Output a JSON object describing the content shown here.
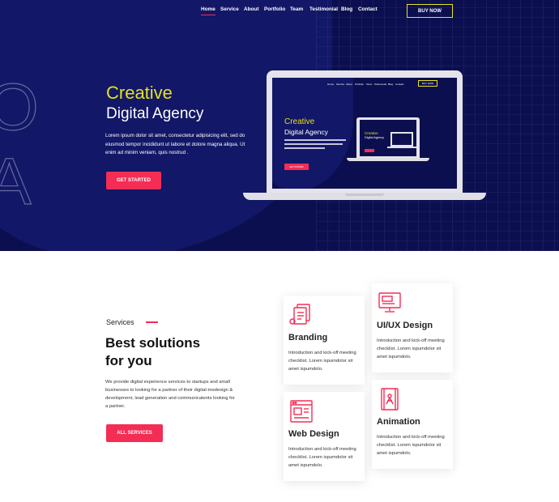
{
  "colors": {
    "navy": "#0c0f4f",
    "accent_red": "#f42d55",
    "accent_yellow": "#e3e11c"
  },
  "nav": {
    "items": [
      "Home",
      "Service",
      "About",
      "Portfolio",
      "Team",
      "Testimonial",
      "Blog",
      "Contact"
    ],
    "active": "Home",
    "buy_label": "BUY NOW"
  },
  "hero": {
    "bg_letters": [
      "O",
      "A"
    ],
    "title_line1": "Creative",
    "title_line2": "Digital Agency",
    "text": "Lorem ipsum dolor sit amet, consectetur adipisicing elit, sed do eiusmod tempor incididunt ut labore et dolore magna aliqua. Ut enim ad minim veniam, quis nostrud .",
    "button_label": "GET STARTED"
  },
  "preview": {
    "nav_items": [
      "Home",
      "Service",
      "About",
      "Portfolio",
      "Team",
      "Testimonial",
      "Blog",
      "Contact"
    ],
    "buy_label": "BUY NOW",
    "title_line1": "Creative",
    "title_line2": "Digital Agency",
    "button_label": "GET STARTED"
  },
  "services": {
    "label": "Services",
    "heading_line1": "Best solutions",
    "heading_line2": "for you",
    "text": "We provide digital experience services to startups and small businesses to looking for a partner of their digital-medesign & development, lead generation and communicatents looking for a partner.",
    "button_label": "ALL SERVICES",
    "cards": [
      {
        "title": "Branding",
        "text": "Introduction and kick-off meeting checklist. Lorem ispumdolor sit amet ispumdolo.",
        "icon": "branding-icon"
      },
      {
        "title": "UI/UX Design",
        "text": "Introduction and kick-off meeting checklist. Lorem ispumdolor sit amet ispumdolo.",
        "icon": "monitor-design-icon"
      },
      {
        "title": "Web Design",
        "text": "Introduction and kick-off meeting checklist. Lorem ispumdolor sit amet ispumdolo.",
        "icon": "web-design-icon"
      },
      {
        "title": "Animation",
        "text": "Introduction and kick-off meeting checklist. Lorem ispumdolor sit amet ispumdolo.",
        "icon": "animation-icon"
      }
    ]
  }
}
